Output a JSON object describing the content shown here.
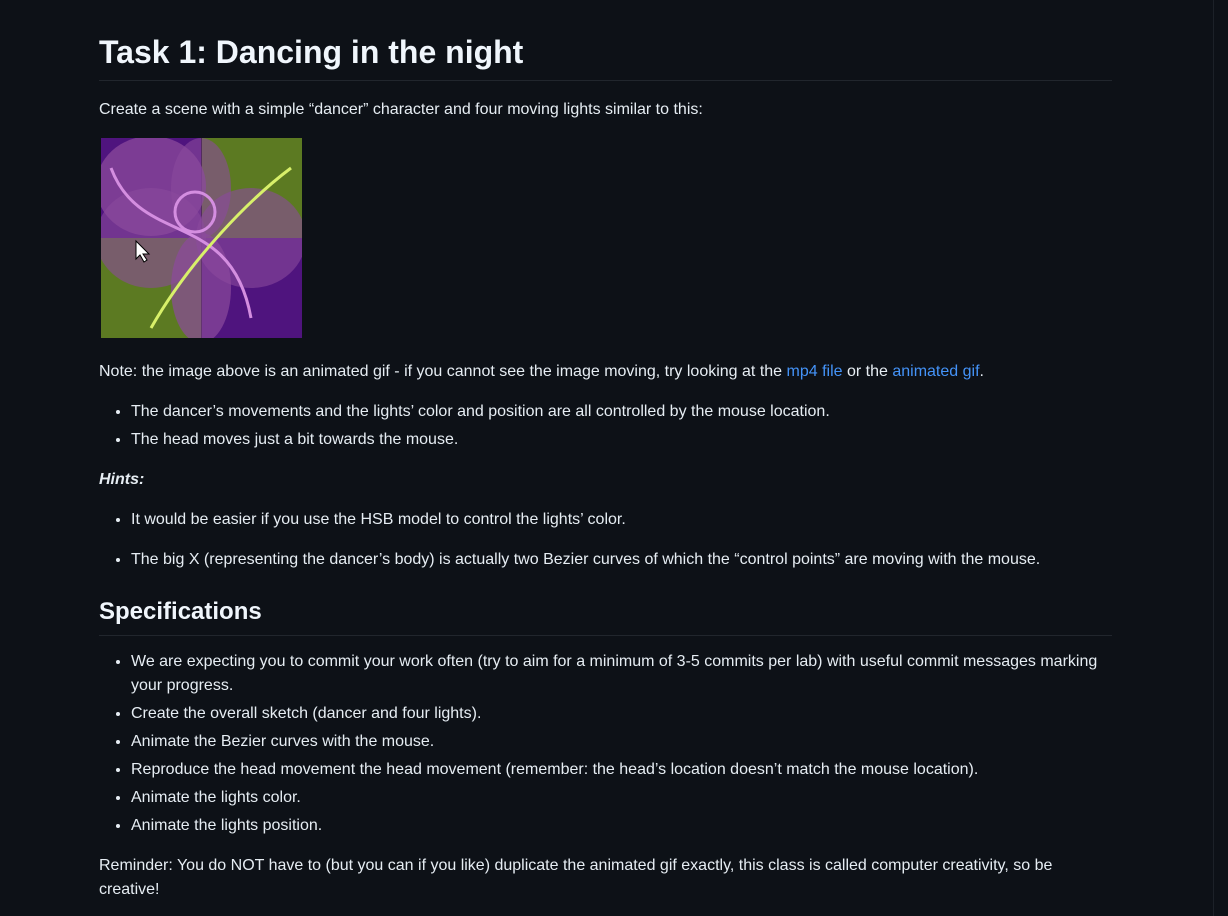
{
  "heading": "Task 1: Dancing in the night",
  "intro": "Create a scene with a simple “dancer” character and four moving lights similar to this:",
  "image_alt": "animated gif preview",
  "note": {
    "before": "Note: the image above is an animated gif - if you cannot see the image moving, try looking at the ",
    "link1": "mp4 file",
    "middle": " or the ",
    "link2": "animated gif",
    "after": "."
  },
  "bullets1": [
    "The dancer’s movements and the lights’ color and position are all controlled by the mouse location.",
    "The head moves just a bit towards the mouse."
  ],
  "hints_label": "Hints:",
  "hints": [
    "It would be easier if you use the HSB model to control the lights’ color.",
    "The big X (representing the dancer’s body) is actually two Bezier curves of which the “control points” are moving with the mouse."
  ],
  "specs_heading": "Specifications",
  "specs": [
    "We are expecting you to commit your work often (try to aim for a minimum of 3-5 commits per lab) with useful commit messages marking your progress.",
    "Create the overall sketch (dancer and four lights).",
    "Animate the Bezier curves with the mouse.",
    "Reproduce the head movement the head movement (remember: the head’s location doesn’t match the mouse location).",
    "Animate the lights color.",
    "Animate the lights position."
  ],
  "reminder": "Reminder: You do NOT have to (but you can if you like) duplicate the animated gif exactly, this class is called computer creativity, so be creative!",
  "colors": {
    "background": "#0d1117",
    "text": "#e6edf3",
    "link": "#4493f8",
    "gif_purple": "#4f147e",
    "gif_green": "#5c7a22",
    "gif_light": "#8b4a9c",
    "gif_curve": "#d48ee0",
    "gif_line": "#d8f06a"
  }
}
